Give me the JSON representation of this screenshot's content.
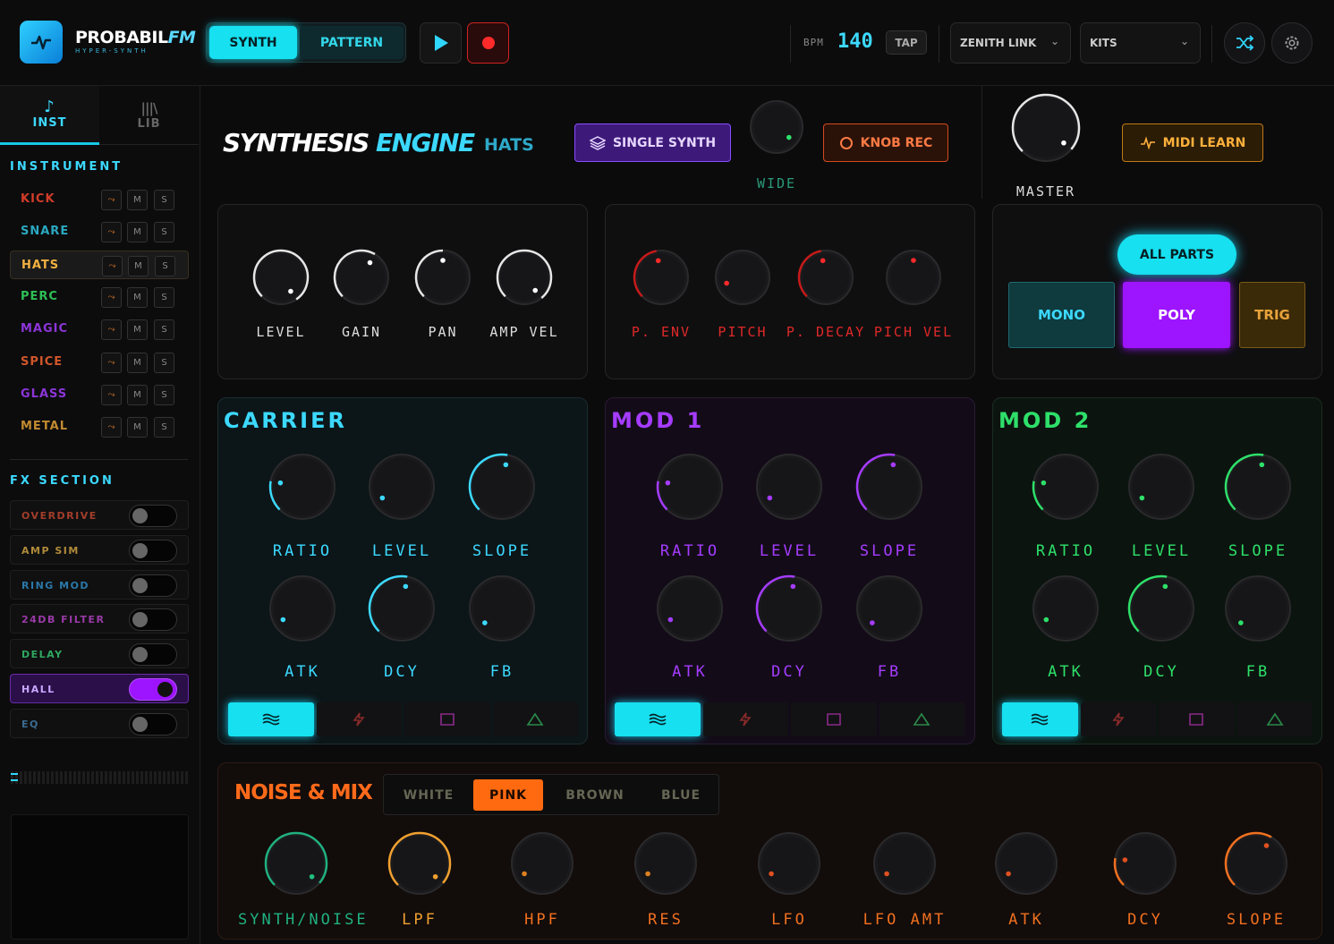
{
  "app": {
    "name_main": "PROBABIL",
    "name_fm": "FM",
    "subtitle": "HYPER-SYNTH"
  },
  "header": {
    "modes": [
      "SYNTH",
      "PATTERN"
    ],
    "active_mode": "SYNTH",
    "bpm_label": "BPM",
    "bpm_value": "140",
    "tap_label": "TAP",
    "link_dropdown": "ZENITH LINK",
    "kits_dropdown": "KITS",
    "icons": [
      "play-icon",
      "record-icon",
      "shuffle-icon",
      "gear-icon"
    ]
  },
  "sidebar": {
    "tabs": [
      {
        "label": "INST",
        "icon": "music-note-icon"
      },
      {
        "label": "LIB",
        "icon": "library-icon"
      }
    ],
    "instrument_title": "INSTRUMENT",
    "instruments": [
      {
        "name": "KICK",
        "color": "#d23c28",
        "selected": false
      },
      {
        "name": "SNARE",
        "color": "#2aa8c0",
        "selected": false
      },
      {
        "name": "HATS",
        "color": "#e8a23a",
        "selected": true
      },
      {
        "name": "PERC",
        "color": "#2fbf55",
        "selected": false
      },
      {
        "name": "MAGIC",
        "color": "#8c35d8",
        "selected": false
      },
      {
        "name": "SPICE",
        "color": "#d0562a",
        "selected": false
      },
      {
        "name": "GLASS",
        "color": "#8c35d8",
        "selected": false
      },
      {
        "name": "METAL",
        "color": "#c08a30",
        "selected": false
      }
    ],
    "instrument_buttons": [
      "M",
      "S"
    ],
    "fx_title": "FX SECTION",
    "fx": [
      {
        "name": "OVERDRIVE",
        "color": "#a33d2a",
        "on": false
      },
      {
        "name": "AMP SIM",
        "color": "#b08a3a",
        "on": false
      },
      {
        "name": "RING MOD",
        "color": "#2a78a8",
        "on": false
      },
      {
        "name": "24DB FILTER",
        "color": "#9a3aa8",
        "on": false
      },
      {
        "name": "DELAY",
        "color": "#2fa860",
        "on": false
      },
      {
        "name": "HALL",
        "color": "#c9a6ff",
        "on": true
      },
      {
        "name": "EQ",
        "color": "#3a6a90",
        "on": false
      }
    ]
  },
  "engine": {
    "title_a": "SYNTHESIS",
    "title_b": "ENGINE",
    "instrument": "HATS",
    "single_synth_label": "SINGLE SYNTH",
    "wide_label": "WIDE",
    "knob_rec_label": "KNOB REC",
    "master_label": "MASTER",
    "midi_learn_label": "MIDI LEARN"
  },
  "amp_panel": {
    "knobs": [
      "LEVEL",
      "GAIN",
      "PAN",
      "AMP VEL"
    ]
  },
  "pitch_panel": {
    "knobs": [
      "P. ENV",
      "PITCH",
      "P. DECAY",
      "PICH VEL"
    ]
  },
  "parts_panel": {
    "all_parts": "ALL PARTS",
    "modes": [
      "MONO",
      "POLY",
      "TRIG"
    ],
    "active": "POLY"
  },
  "operators": [
    {
      "title": "CARRIER",
      "color": "#3cd9ff",
      "knobs": [
        "RATIO",
        "LEVEL",
        "SLOPE",
        "ATK",
        "DCY",
        "FB"
      ]
    },
    {
      "title": "MOD 1",
      "color": "#a53cff",
      "knobs": [
        "RATIO",
        "LEVEL",
        "SLOPE",
        "ATK",
        "DCY",
        "FB"
      ]
    },
    {
      "title": "MOD 2",
      "color": "#2ee06a",
      "knobs": [
        "RATIO",
        "LEVEL",
        "SLOPE",
        "ATK",
        "DCY",
        "FB"
      ]
    }
  ],
  "waveforms": [
    "waves-icon",
    "bolt-icon",
    "square-icon",
    "triangle-icon"
  ],
  "noise": {
    "title": "NOISE & MIX",
    "types": [
      "WHITE",
      "PINK",
      "BROWN",
      "BLUE"
    ],
    "active_type": "PINK",
    "knobs": [
      "SYNTH/NOISE",
      "LPF",
      "HPF",
      "RES",
      "LFO",
      "LFO AMT",
      "ATK",
      "DCY",
      "SLOPE"
    ]
  }
}
